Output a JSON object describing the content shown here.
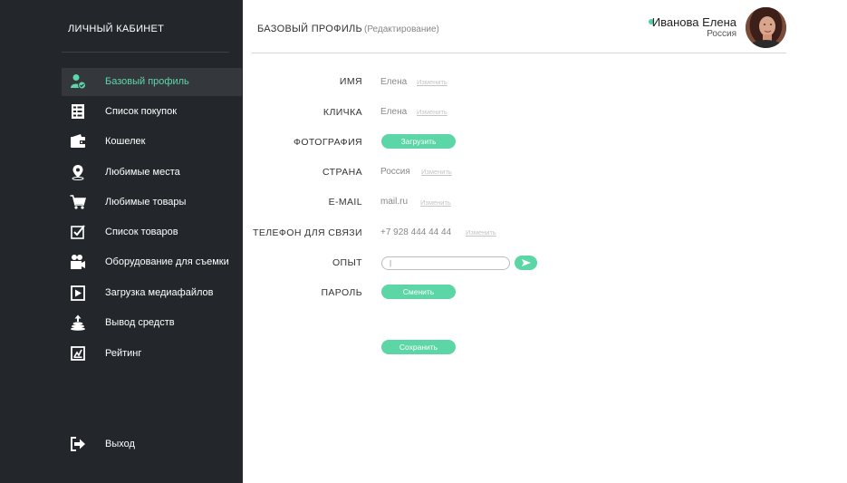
{
  "sidebar": {
    "title": "ЛИЧНЫЙ КАБИНЕТ",
    "items": [
      {
        "label": "Базовый профиль",
        "icon": "user-check-icon",
        "active": true
      },
      {
        "label": "Список покупок",
        "icon": "checklist-icon"
      },
      {
        "label": "Кошелек",
        "icon": "wallet-icon"
      },
      {
        "label": "Любимые места",
        "icon": "map-pin-icon"
      },
      {
        "label": "Любимые товары",
        "icon": "cart-icon"
      },
      {
        "label": "Список товаров",
        "icon": "check-square-icon"
      },
      {
        "label": "Оборудование для съемки",
        "icon": "video-camera-icon"
      },
      {
        "label": "Загрузка медиафайлов",
        "icon": "media-play-icon"
      },
      {
        "label": "Вывод средств",
        "icon": "coins-upload-icon"
      },
      {
        "label": "Рейтинг",
        "icon": "chart-icon"
      }
    ],
    "logout": {
      "label": "Выход",
      "icon": "logout-icon"
    }
  },
  "header": {
    "title": "БАЗОВЫЙ ПРОФИЛЬ",
    "subtitle": "(Редактирование)"
  },
  "user": {
    "name": "Иванова Елена",
    "country": "Россия",
    "status_color": "#4fd1a0"
  },
  "form": {
    "edit_label": "Изменить",
    "name": {
      "label": "ИМЯ",
      "value": "Елена"
    },
    "nickname": {
      "label": "КЛИЧКА",
      "value": "Елена"
    },
    "photo": {
      "label": "ФОТОГРАФИЯ",
      "button": "Загрузить"
    },
    "country": {
      "label": "СТРАНА",
      "value": "Россия"
    },
    "email": {
      "label": "E-MAIL",
      "value": "mail.ru"
    },
    "phone": {
      "label": "ТЕЛЕФОН ДЛЯ СВЯЗИ",
      "value": "+7 928 444 44 44"
    },
    "experience": {
      "label": "ОПЫТ",
      "value": "|"
    },
    "password": {
      "label": "ПАРОЛЬ",
      "button": "Сменить"
    },
    "save_button": "Сохранить"
  },
  "colors": {
    "accent": "#5cd6a6",
    "sidebar_bg": "#23272b"
  }
}
